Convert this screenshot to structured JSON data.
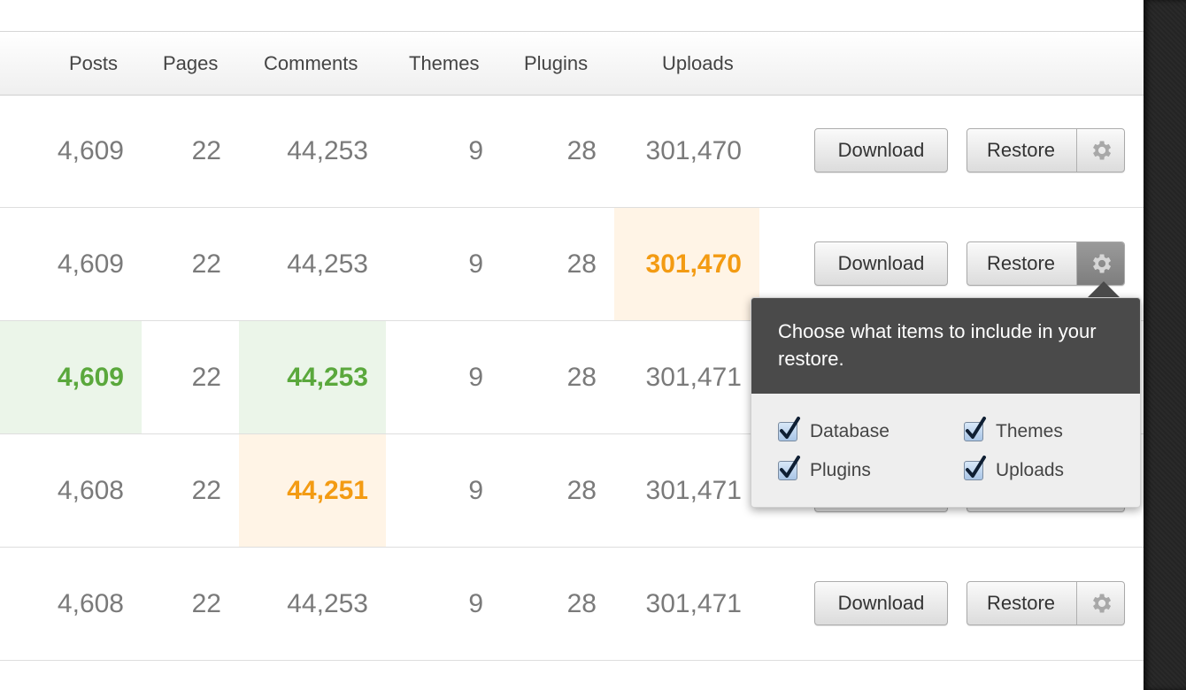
{
  "columns": [
    "Posts",
    "Pages",
    "Comments",
    "Themes",
    "Plugins",
    "Uploads"
  ],
  "rows": [
    {
      "posts": "4,609",
      "pages": "22",
      "comments": "44,253",
      "themes": "9",
      "plugins": "28",
      "uploads": "301,470"
    },
    {
      "posts": "4,609",
      "pages": "22",
      "comments": "44,253",
      "themes": "9",
      "plugins": "28",
      "uploads": "301,470"
    },
    {
      "posts": "4,609",
      "pages": "22",
      "comments": "44,253",
      "themes": "9",
      "plugins": "28",
      "uploads": "301,471"
    },
    {
      "posts": "4,608",
      "pages": "22",
      "comments": "44,251",
      "themes": "9",
      "plugins": "28",
      "uploads": "301,471"
    },
    {
      "posts": "4,608",
      "pages": "22",
      "comments": "44,253",
      "themes": "9",
      "plugins": "28",
      "uploads": "301,471"
    }
  ],
  "actions": {
    "download_label": "Download",
    "restore_label": "Restore"
  },
  "popover": {
    "message": "Choose what items to include in your restore.",
    "options": [
      "Database",
      "Themes",
      "Plugins",
      "Uploads"
    ],
    "checked": [
      true,
      true,
      true,
      true
    ]
  },
  "colors": {
    "increase": "#5aa83c",
    "change": "#f39b13",
    "accent": "#4a4a4a"
  },
  "icons": {
    "settings": "gear-icon",
    "checkbox": "checkmark-icon"
  }
}
